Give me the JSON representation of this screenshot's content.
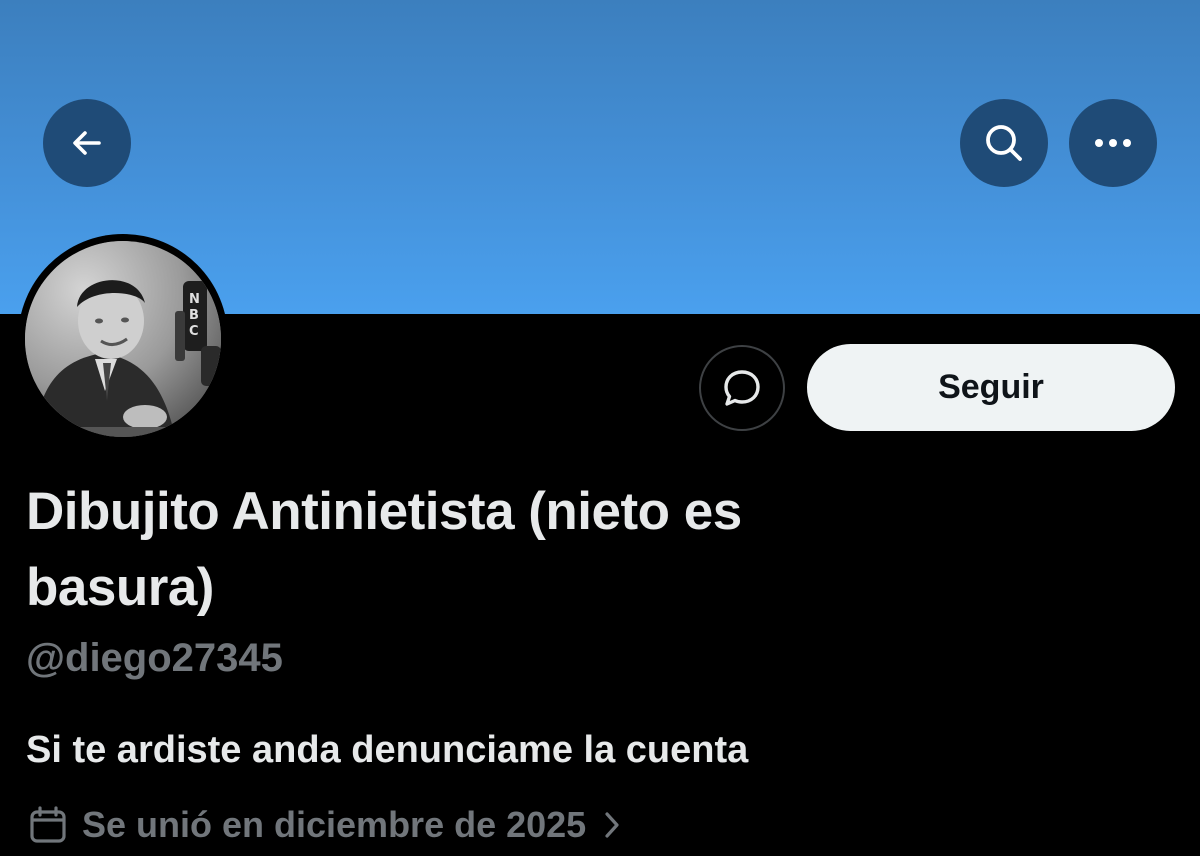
{
  "header": {
    "back_icon": "arrow-left-icon",
    "search_icon": "search-icon",
    "more_icon": "more-horizontal-icon",
    "banner_color": "#4490d8",
    "button_color": "#1f4b77"
  },
  "profile": {
    "display_name": "Dibujito Antinietista (nieto es basura)",
    "handle": "@diego27345",
    "bio": "Si te ardiste anda denunciame la cuenta",
    "joined": "Se unió en diciembre de 2025",
    "avatar_icon": "avatar-photo"
  },
  "actions": {
    "message_icon": "message-bubble-icon",
    "follow_label": "Seguir"
  },
  "colors": {
    "background": "#000000",
    "primary_text": "#e7e9ea",
    "secondary_text": "#71767b",
    "follow_button_bg": "#eff3f4"
  }
}
